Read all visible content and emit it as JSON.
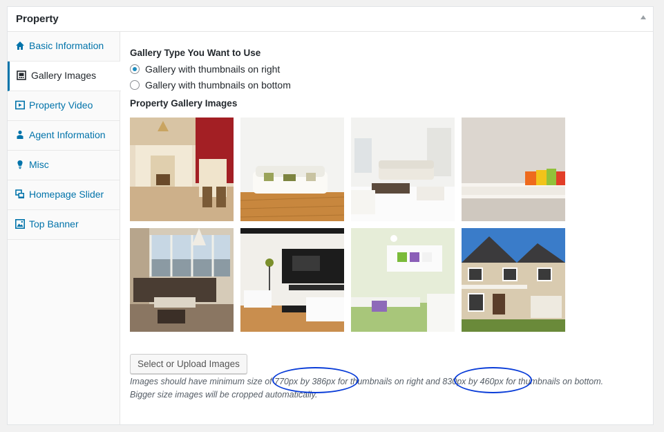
{
  "metabox": {
    "title": "Property"
  },
  "sidebar": {
    "tabs": [
      {
        "label": "Basic Information",
        "icon": "home-icon"
      },
      {
        "label": "Gallery Images",
        "icon": "gallery-icon"
      },
      {
        "label": "Property Video",
        "icon": "video-icon"
      },
      {
        "label": "Agent Information",
        "icon": "person-icon"
      },
      {
        "label": "Misc",
        "icon": "lightbulb-icon"
      },
      {
        "label": "Homepage Slider",
        "icon": "slides-icon"
      },
      {
        "label": "Top Banner",
        "icon": "image-icon"
      }
    ],
    "active_index": 1
  },
  "gallery_type": {
    "label": "Gallery Type You Want to Use",
    "options": [
      {
        "label": "Gallery with thumbnails on right",
        "checked": true
      },
      {
        "label": "Gallery with thumbnails on bottom",
        "checked": false
      }
    ]
  },
  "gallery": {
    "label": "Property Gallery Images",
    "images": [
      "kitchen-red-wall-image",
      "white-sofa-wood-floor-image",
      "white-living-room-image",
      "white-sofa-orange-cushions-image",
      "brown-sofa-window-view-image",
      "modern-tv-living-room-image",
      "kids-room-shelves-image",
      "suburban-house-exterior-image"
    ]
  },
  "upload_button": "Select or Upload Images",
  "help": {
    "part1": "Images should have minimum size of ",
    "size_right": "770px by 386px",
    "part2": " for thumbnails on right and ",
    "size_bottom": "830px by 460px",
    "part3": " for thumbnails on bottom.",
    "line2": "Bigger size images will be cropped automatically."
  },
  "colors": {
    "accent": "#0073aa",
    "annotation": "#0a3dd8"
  }
}
